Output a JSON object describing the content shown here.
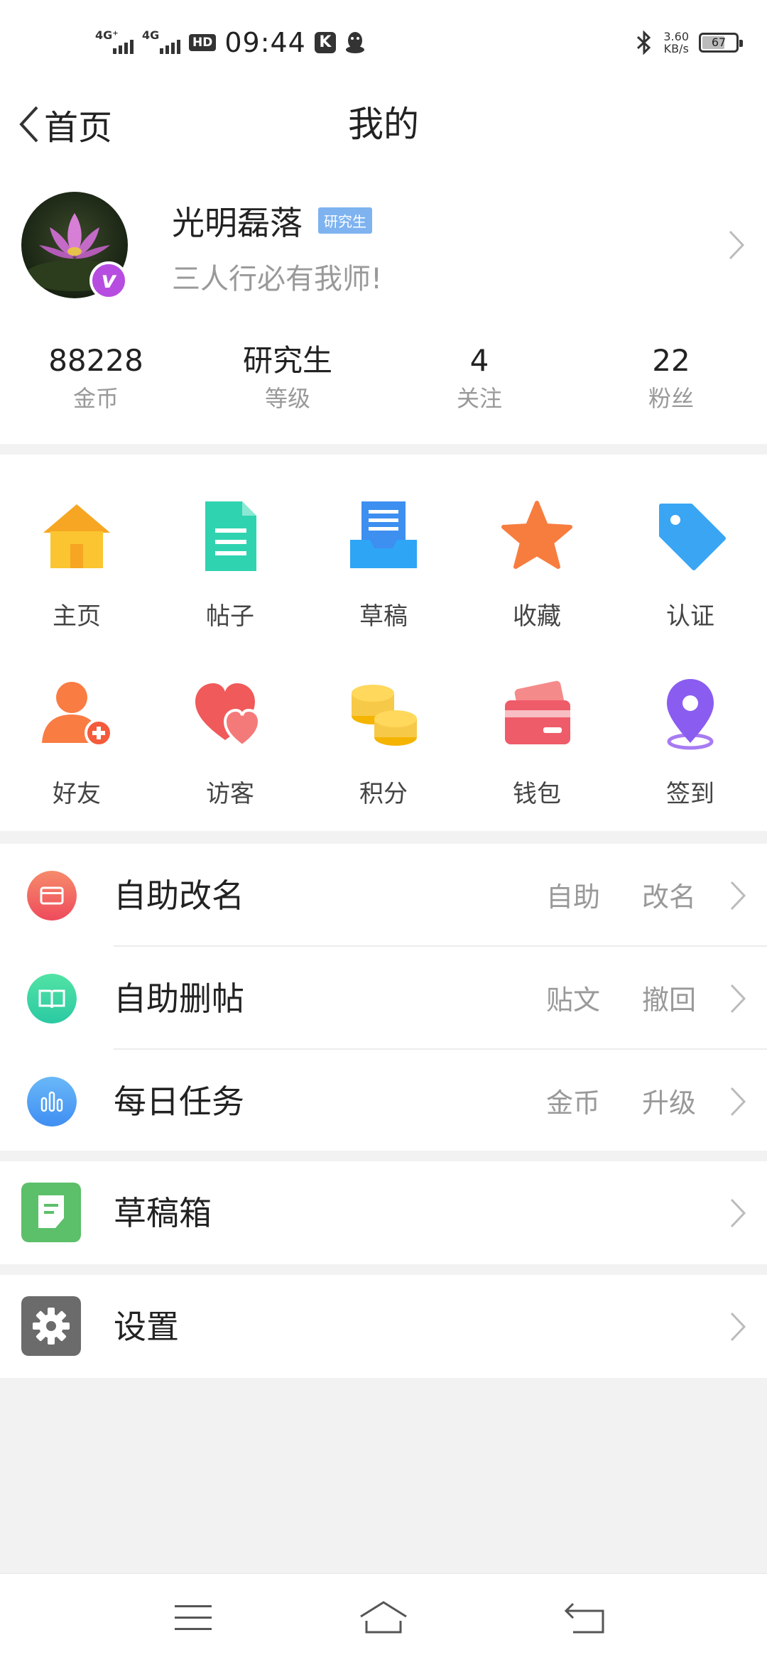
{
  "status_bar": {
    "net1": "4G⁺",
    "net2": "4G",
    "hd": "HD",
    "time": "09:44",
    "k_app": "K",
    "speed_value": "3.60",
    "speed_unit": "KB/s",
    "battery": "67",
    "battery_level": 0.67
  },
  "nav": {
    "back_label": "首页",
    "title": "我的"
  },
  "profile": {
    "username": "光明磊落",
    "level_tag": "研究生",
    "verified_badge": "v",
    "signature": "三人行必有我师!",
    "stats": [
      {
        "value": "88228",
        "label": "金币"
      },
      {
        "value": "研究生",
        "label": "等级"
      },
      {
        "value": "4",
        "label": "关注"
      },
      {
        "value": "22",
        "label": "粉丝"
      }
    ]
  },
  "grid": [
    {
      "label": "主页",
      "icon": "home-icon"
    },
    {
      "label": "帖子",
      "icon": "post-document-icon"
    },
    {
      "label": "草稿",
      "icon": "draft-tray-icon"
    },
    {
      "label": "收藏",
      "icon": "star-icon"
    },
    {
      "label": "认证",
      "icon": "tag-icon"
    },
    {
      "label": "好友",
      "icon": "add-friend-icon"
    },
    {
      "label": "访客",
      "icon": "visitor-hearts-icon"
    },
    {
      "label": "积分",
      "icon": "coins-icon"
    },
    {
      "label": "钱包",
      "icon": "wallet-icon"
    },
    {
      "label": "签到",
      "icon": "location-pin-icon"
    }
  ],
  "tools": [
    {
      "title": "自助改名",
      "tag1": "自助",
      "tag2": "改名",
      "icon": "rename-card-icon",
      "color": "#f2685b"
    },
    {
      "title": "自助删帖",
      "tag1": "贴文",
      "tag2": "撤回",
      "icon": "open-book-icon",
      "color": "#3ed6a0"
    },
    {
      "title": "每日任务",
      "tag1": "金币",
      "tag2": "升级",
      "icon": "bar-chart-icon",
      "color": "#4d9ef5"
    }
  ],
  "drafts": {
    "title": "草稿箱",
    "icon": "draft-box-icon",
    "color": "#5cbf6a"
  },
  "settings": {
    "title": "设置",
    "icon": "gear-icon",
    "color": "#6b6b6b"
  },
  "colors": {
    "background": "#f2f2f2",
    "card": "#ffffff",
    "level_tag": "#7eb3f0",
    "verified": "#b64de0"
  }
}
